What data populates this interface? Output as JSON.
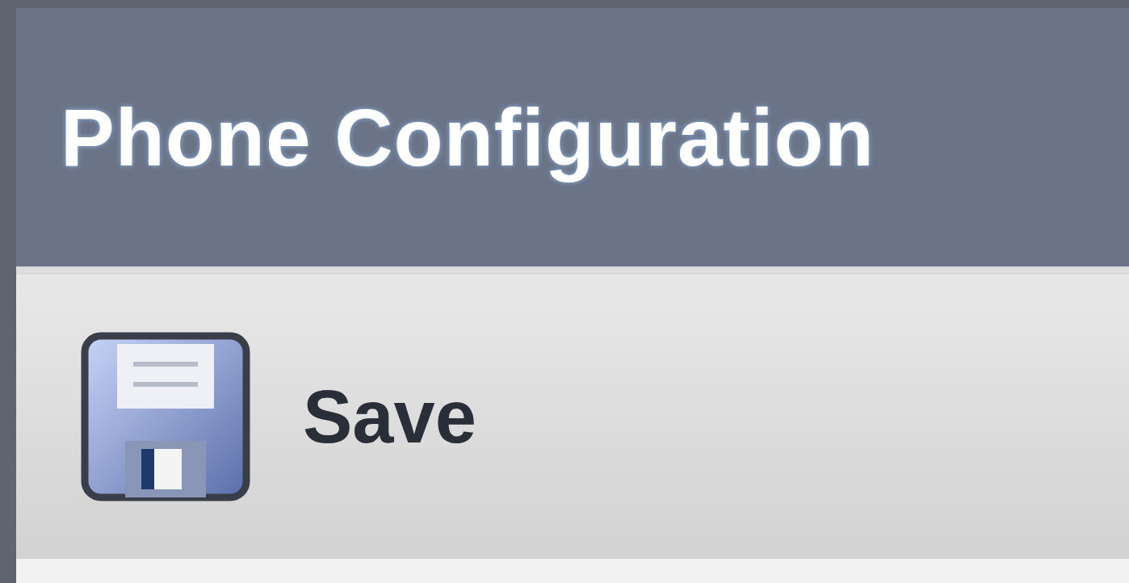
{
  "window": {
    "title": "Phone Configuration"
  },
  "toolbar": {
    "buttons": [
      {
        "label": "Save"
      }
    ]
  }
}
